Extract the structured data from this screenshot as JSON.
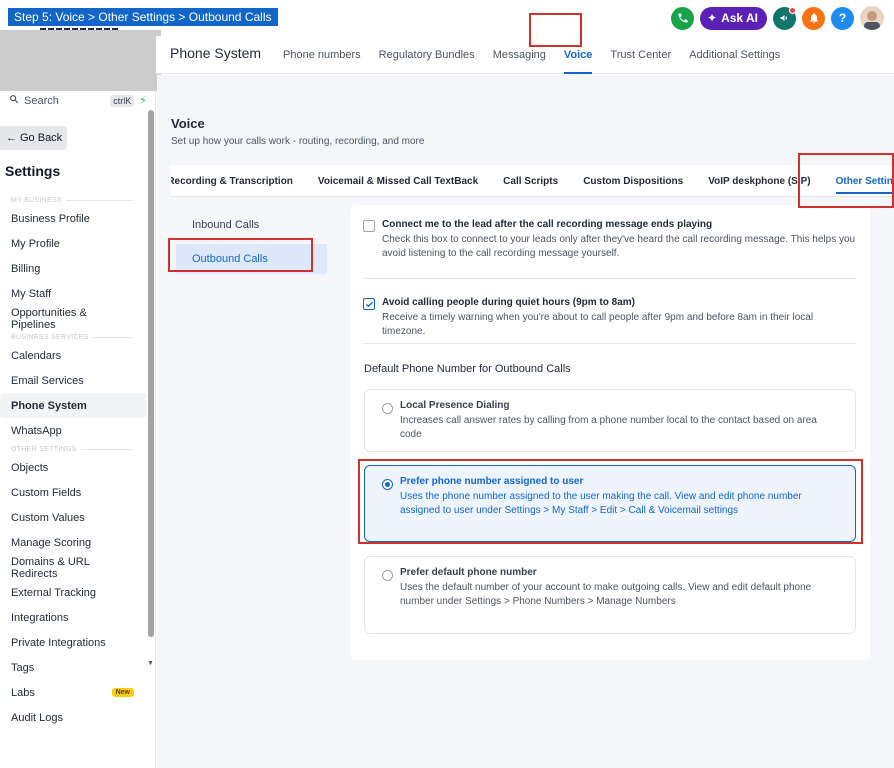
{
  "step_banner": "Step 5: Voice > Other Settings > Outbound Calls",
  "topbar": {
    "ask_ai_label": "Ask AI",
    "help_label": "?",
    "colors": {
      "phone": "#16a34a",
      "ask_ai": "#5b21b6",
      "megaphone": "#0f766e",
      "bell": "#f97316",
      "help": "#1d8cf0"
    }
  },
  "sidebar": {
    "search_label": "Search",
    "search_shortcut": "ctrlK",
    "go_back_label": "Go Back",
    "title": "Settings",
    "sections": [
      {
        "label": "MY BUSINESS",
        "items": [
          "Business Profile",
          "My Profile",
          "Billing",
          "My Staff",
          "Opportunities & Pipelines"
        ]
      },
      {
        "label": "BUSINESS SERVICES",
        "items": [
          "Calendars",
          "Email Services",
          "Phone System",
          "WhatsApp"
        ]
      },
      {
        "label": "OTHER SETTINGS",
        "items": [
          "Objects",
          "Custom Fields",
          "Custom Values",
          "Manage Scoring",
          "Domains & URL Redirects",
          "External Tracking",
          "Integrations",
          "Private Integrations",
          "Tags",
          "Labs",
          "Audit Logs"
        ]
      }
    ],
    "active_item": "Phone System",
    "labs_badge": "New"
  },
  "top_nav": {
    "page_title": "Phone System",
    "tabs": [
      "Phone numbers",
      "Regulatory Bundles",
      "Messaging",
      "Voice",
      "Trust Center",
      "Additional Settings"
    ],
    "active_tab": "Voice"
  },
  "voice": {
    "title": "Voice",
    "subtitle": "Set up how your calls work - routing, recording, and more",
    "sub_tabs": [
      "ll Recording & Transcription",
      "Voicemail & Missed Call TextBack",
      "Call Scripts",
      "Custom Dispositions",
      "VoIP deskphone (SIP)",
      "Other Settings"
    ],
    "active_sub_tab": "Other Settings"
  },
  "left_menu": {
    "items": [
      "Inbound Calls",
      "Outbound Calls"
    ],
    "active": "Outbound Calls"
  },
  "outbound": {
    "checks": [
      {
        "title": "Connect me to the lead after the call recording message ends playing",
        "desc": "Check this box to connect to your leads only after they've heard the call recording message. This helps you avoid listening to the call recording message yourself.",
        "checked": false
      },
      {
        "title": "Avoid calling people during quiet hours (9pm to 8am)",
        "desc": "Receive a timely warning when you're about to call people after 9pm and before 8am in their local timezone.",
        "checked": true
      }
    ],
    "group_title": "Default Phone Number for Outbound Calls",
    "options": [
      {
        "title": "Local Presence Dialing",
        "desc": "Increases call answer rates by calling from a phone number local to the contact based on area code",
        "selected": false
      },
      {
        "title": "Prefer phone number assigned to user",
        "desc": "Uses the phone number assigned to the user making the call. View and edit phone number assigned to user under Settings > My Staff > Edit > Call & Voicemail settings",
        "selected": true
      },
      {
        "title": "Prefer default phone number",
        "desc": "Uses the default number of your account to make outgoing calls. View and edit default phone number under Settings > Phone Numbers > Manage Numbers",
        "selected": false
      }
    ]
  }
}
